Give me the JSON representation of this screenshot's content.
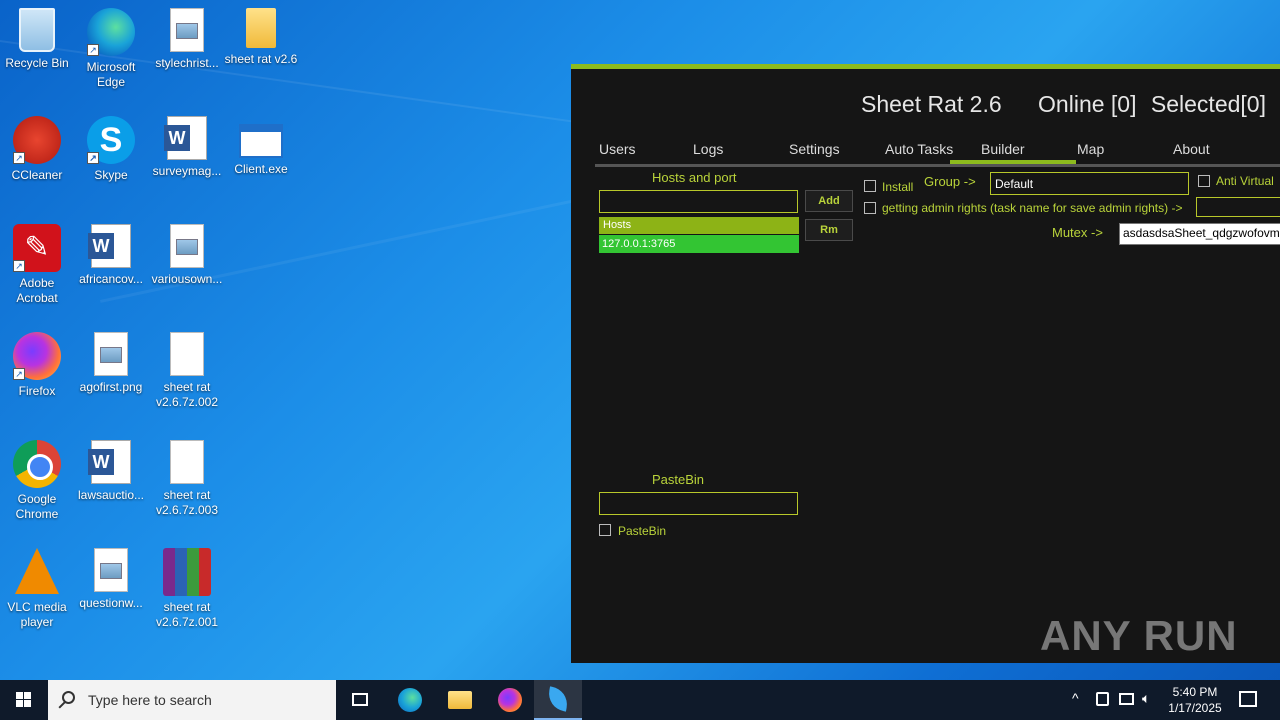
{
  "desktop": {
    "icons": [
      {
        "label": "Recycle Bin"
      },
      {
        "label": "Microsoft Edge"
      },
      {
        "label": "stylechrist..."
      },
      {
        "label": "sheet rat v2.6"
      },
      {
        "label": "CCleaner"
      },
      {
        "label": "Skype"
      },
      {
        "label": "surveymag..."
      },
      {
        "label": "Client.exe"
      },
      {
        "label": "Adobe Acrobat"
      },
      {
        "label": "africancov..."
      },
      {
        "label": "variousown..."
      },
      {
        "label": "Firefox"
      },
      {
        "label": "agofirst.png"
      },
      {
        "label": "sheet rat v2.6.7z.002"
      },
      {
        "label": "Google Chrome"
      },
      {
        "label": "lawsauctio..."
      },
      {
        "label": "sheet rat v2.6.7z.003"
      },
      {
        "label": "VLC media player"
      },
      {
        "label": "questionw..."
      },
      {
        "label": "sheet rat v2.6.7z.001"
      }
    ]
  },
  "app": {
    "title": "Sheet Rat 2.6",
    "online": "Online [0]",
    "selected": "Selected[0]",
    "title_tail": "Se",
    "tabs": [
      "Users",
      "Logs",
      "Settings",
      "Auto Tasks",
      "Builder",
      "Map",
      "About"
    ],
    "active_tab": "Builder",
    "accent": "#8dbb1e",
    "builder": {
      "hosts_label": "Hosts and port",
      "hosts_input": "",
      "add_button": "Add",
      "rm_button": "Rm",
      "hosts_header": "Hosts",
      "hosts": [
        "127.0.0.1:3765"
      ],
      "install_label": "Install",
      "group_label": "Group ->",
      "group_value": "Default",
      "anti_virtual_label": "Anti Virtual",
      "admin_label": "getting admin rights (task name for save admin rights) ->",
      "admin_value": "",
      "mutex_label": "Mutex ->",
      "mutex_value": "asdasdsaSheet_qdgzwofovmn",
      "pastebin_label": "PasteBin",
      "pastebin_input": "",
      "pastebin_checkbox_label": "PasteBin"
    }
  },
  "watermark": "ANY RUN",
  "taskbar": {
    "search_placeholder": "Type here to search",
    "time": "5:40 PM",
    "date": "1/17/2025"
  }
}
